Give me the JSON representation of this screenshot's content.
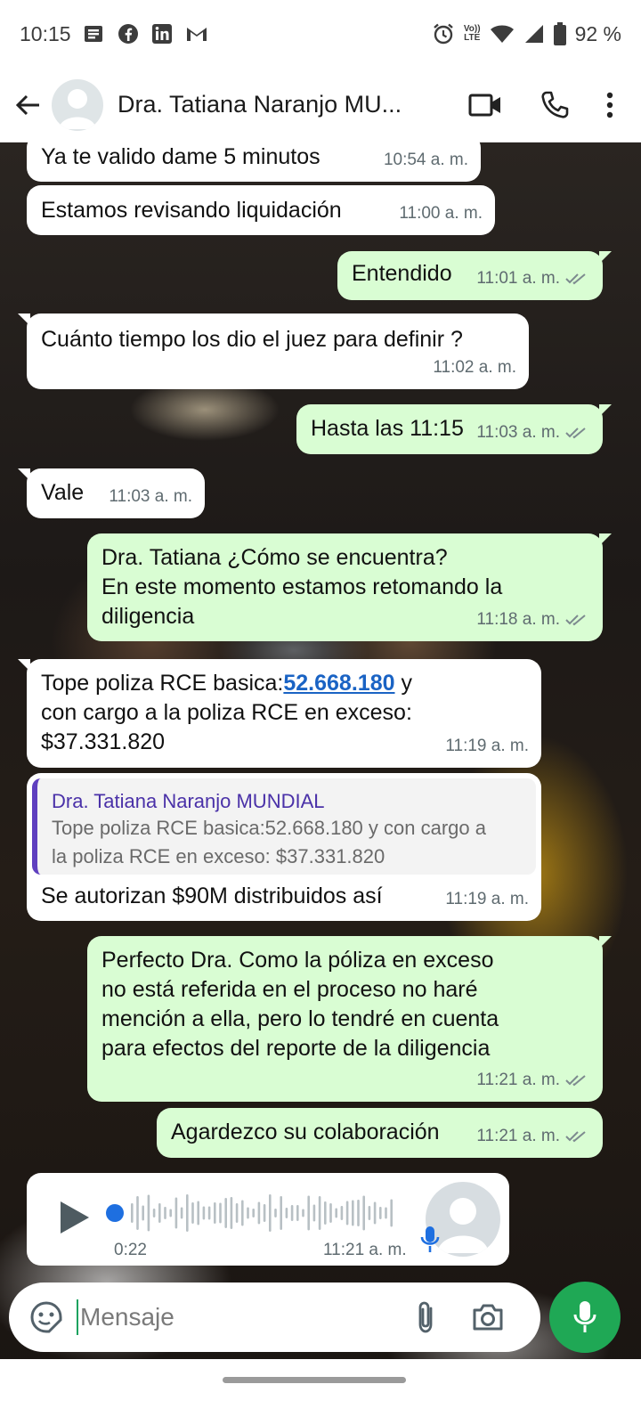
{
  "status_bar": {
    "time": "10:15",
    "battery": "92 %",
    "left_icons": [
      "news-icon",
      "facebook-icon",
      "linkedin-icon",
      "gmail-icon"
    ],
    "right_icons": [
      "alarm-icon",
      "volte-icon",
      "wifi-icon",
      "signal-icon",
      "battery-icon"
    ],
    "volte_label_1": "Vo))",
    "volte_label_2": "LTE"
  },
  "header": {
    "contact_name": "Dra. Tatiana Naranjo MU..."
  },
  "messages": [
    {
      "direction": "in",
      "text": "Ya te valido dame 5 minutos",
      "time": "10:54 a. m."
    },
    {
      "direction": "in",
      "text": "Estamos revisando liquidación",
      "time": "11:00 a. m."
    },
    {
      "direction": "out",
      "text": "Entendido",
      "time": "11:01 a. m.",
      "read": true
    },
    {
      "direction": "in",
      "text": "Cuánto tiempo los dio el juez para definir ?",
      "time": "11:02 a. m."
    },
    {
      "direction": "out",
      "text": "Hasta las 11:15",
      "time": "11:03 a. m.",
      "read": true
    },
    {
      "direction": "in",
      "text": "Vale",
      "time": "11:03 a. m."
    },
    {
      "direction": "out",
      "lines": [
        "Dra. Tatiana ¿Cómo se encuentra?",
        "En este momento estamos retomando la",
        "diligencia"
      ],
      "time": "11:18 a. m.",
      "read": true
    },
    {
      "direction": "in",
      "line1_prefix": "Tope poliza RCE basica:",
      "line1_link": "52.668.180",
      "line1_suffix": " y",
      "line2": "con cargo a la poliza RCE en exceso:",
      "line3": "$37.331.820",
      "time": "11:19 a. m."
    },
    {
      "direction": "in",
      "quote_author": "Dra. Tatiana Naranjo MUNDIAL",
      "quote_line1": "Tope poliza RCE basica:52.668.180 y con cargo a",
      "quote_line2": "la poliza RCE en exceso: $37.331.820",
      "text": "Se autorizan $90M distribuidos así",
      "time": "11:19 a. m."
    },
    {
      "direction": "out",
      "lines": [
        "Perfecto Dra. Como la póliza en exceso",
        "no está referida en el proceso no haré",
        "mención a ella, pero lo tendré en cuenta",
        "para efectos del reporte de la diligencia"
      ],
      "time": "11:21 a. m.",
      "read": true
    },
    {
      "direction": "out",
      "text": "Agardezco su colaboración",
      "time": "11:21 a. m.",
      "read": true
    }
  ],
  "voice_note": {
    "duration": "0:22",
    "time": "11:21 a. m.",
    "progress": 0
  },
  "composer": {
    "placeholder": "Mensaje"
  },
  "colors": {
    "incoming_bubble": "#ffffff",
    "outgoing_bubble": "#d9fdd3",
    "accent_green": "#1fa855",
    "link_blue": "#1a63c4",
    "quote_bar": "#5f3fbf"
  }
}
